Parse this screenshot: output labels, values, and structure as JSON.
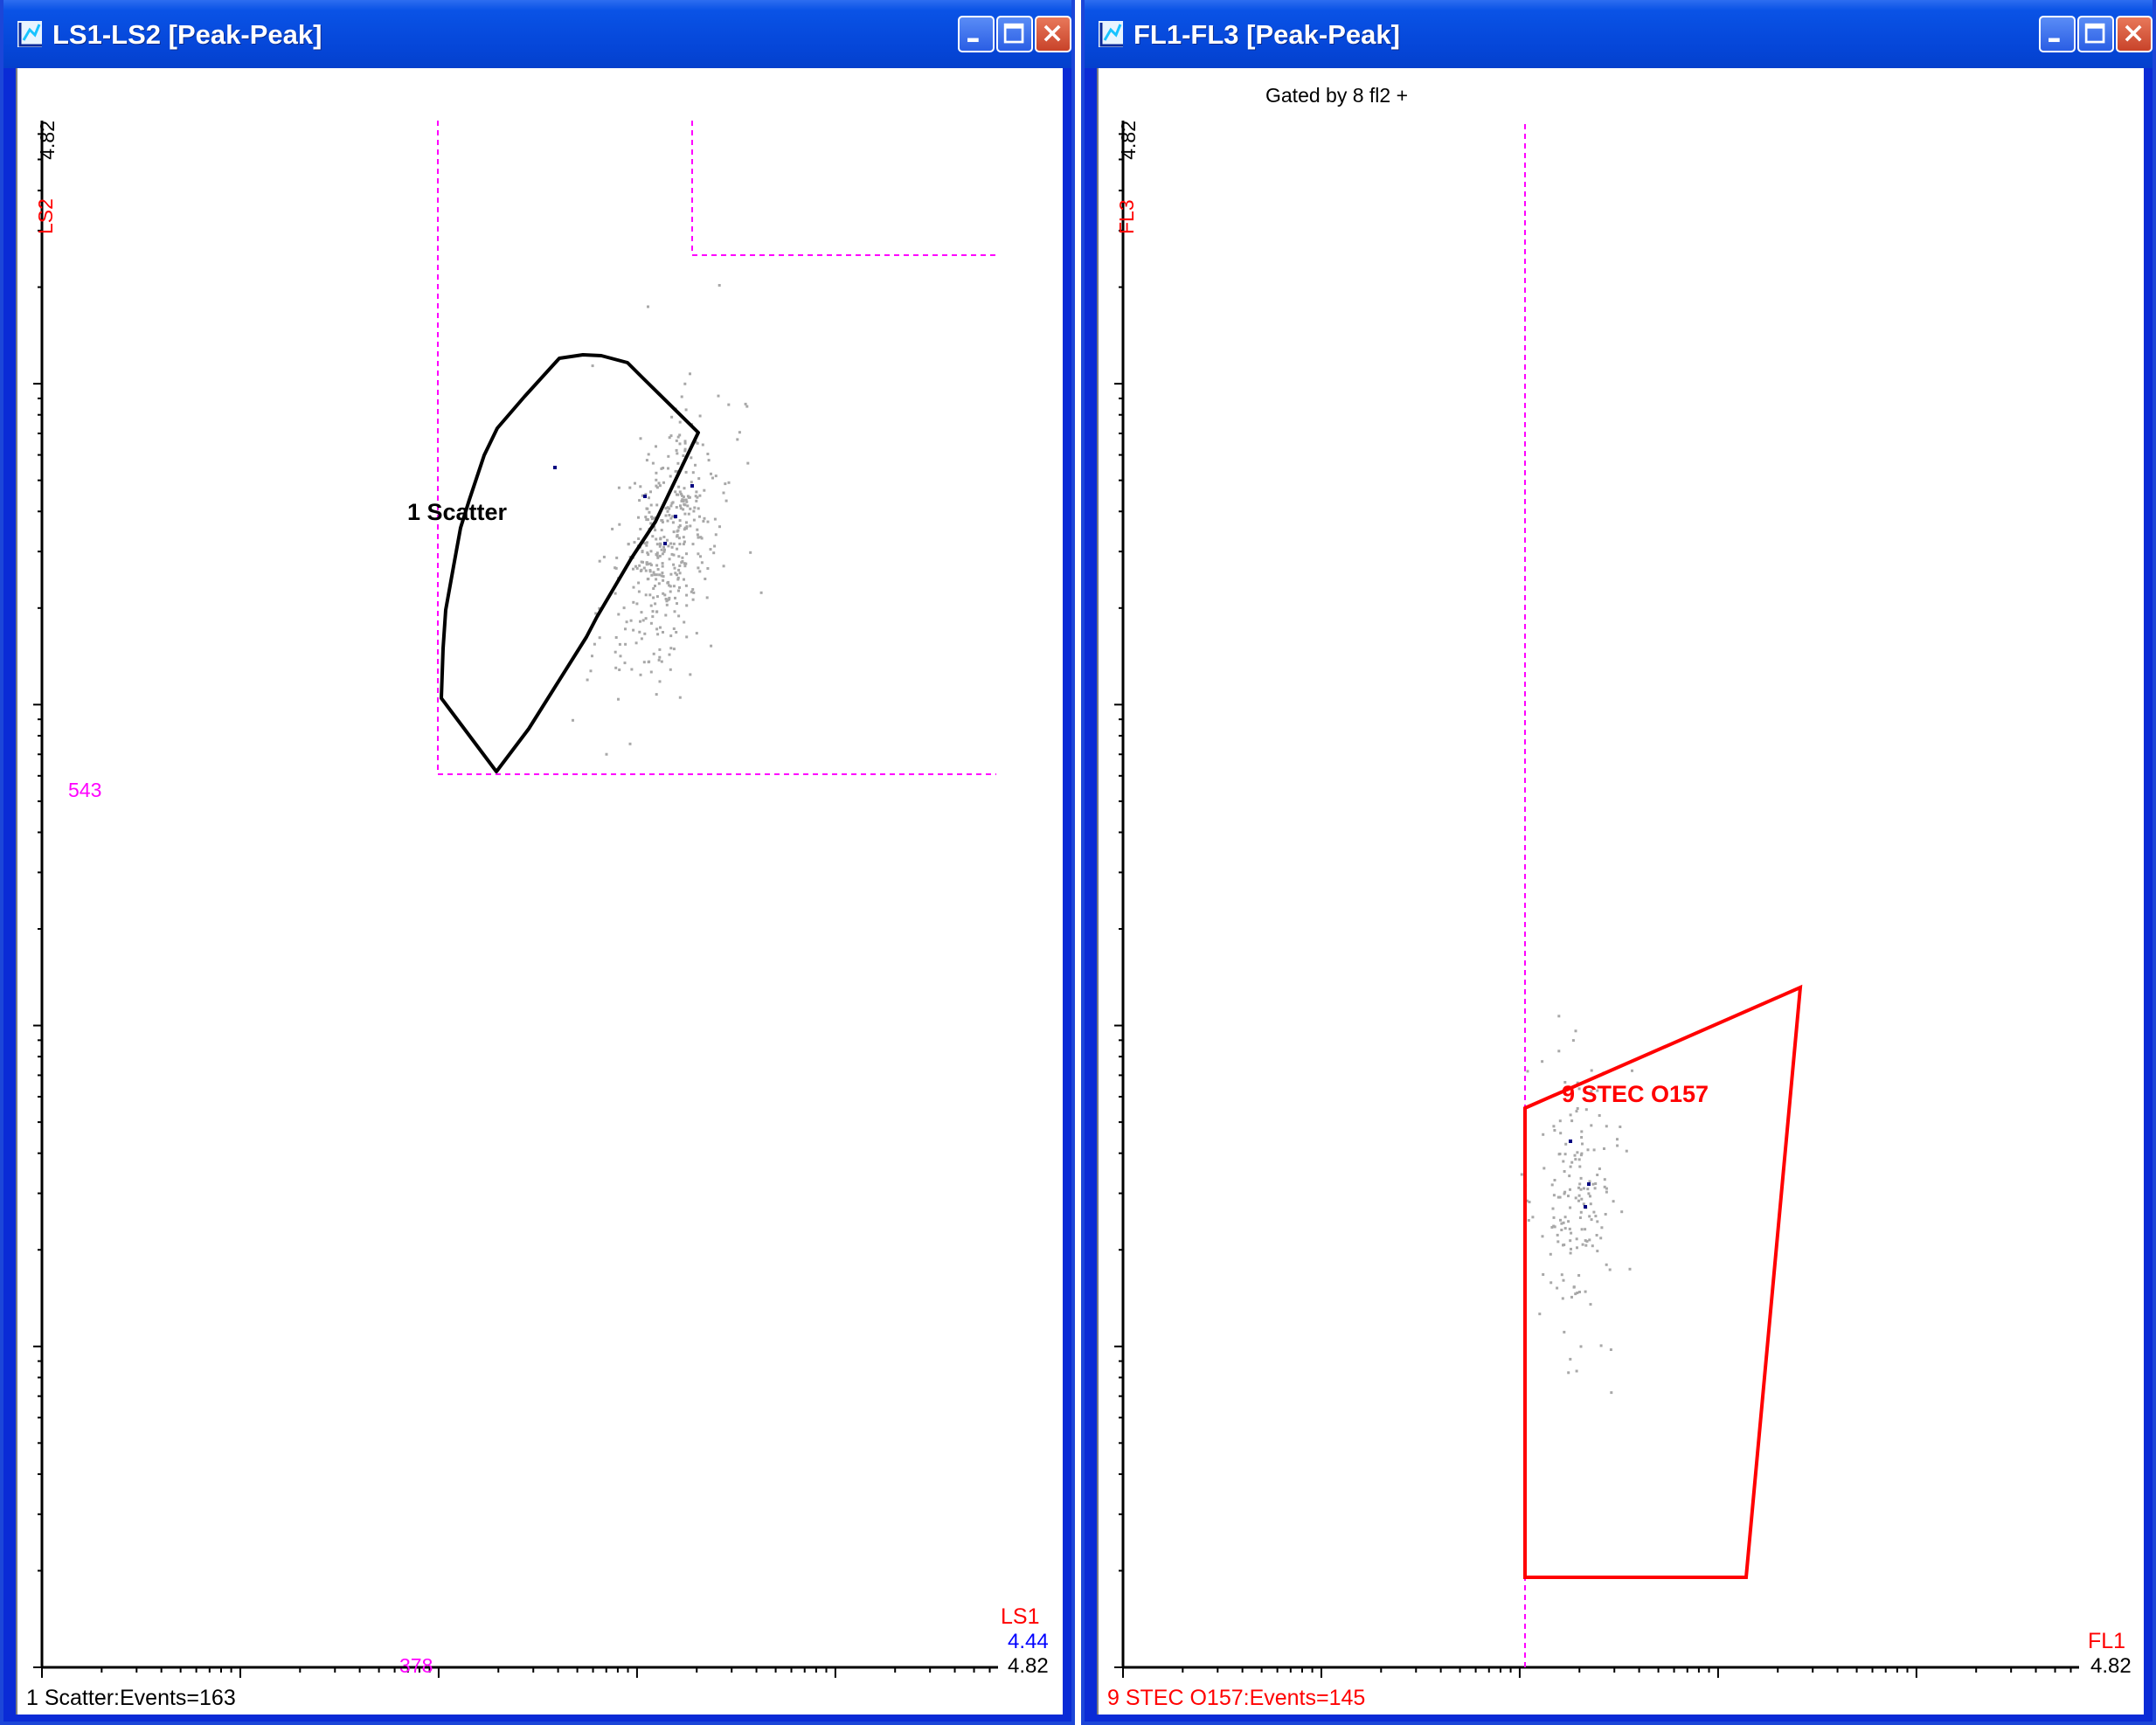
{
  "left_window": {
    "title": "LS1-LS2 [Peak-Peak]",
    "y_max_label": "4.82",
    "y_param": "LS2",
    "x_param": "LS1",
    "x_cursor_value": "4.44",
    "x_max_label": "4.82",
    "quadrant_count_a": "543",
    "quadrant_count_b": "378",
    "gate_label": "1 Scatter",
    "status": "1 Scatter:Events=163"
  },
  "right_window": {
    "title": "FL1-FL3 [Peak-Peak]",
    "gating_note": "Gated by 8 fl2 +",
    "y_max_label": "4.82",
    "y_param": "FL3",
    "x_param": "FL1",
    "x_max_label": "4.82",
    "gate_label": "9 STEC O157",
    "status": "9 STEC O157:Events=145"
  },
  "colors": {
    "title_bar": "#0546d8",
    "axis_param": "#ff0000",
    "quadrant_line": "#ff00ff",
    "cursor_value": "#0000ff",
    "gate_left": "#000000",
    "gate_right": "#ff0000",
    "dots": "#a8a8a8",
    "gated_dots": "#000080"
  },
  "icons": [
    "plot-window-icon",
    "minimize-icon",
    "maximize-icon",
    "close-icon"
  ]
}
